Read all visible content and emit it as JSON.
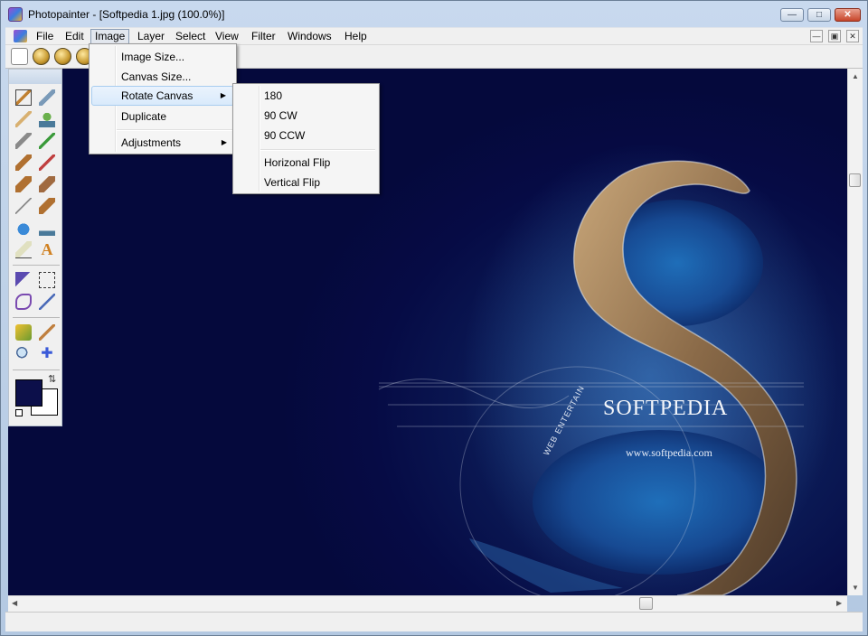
{
  "window": {
    "title": "Photopainter - [Softpedia 1.jpg  (100.0%)]",
    "controls": [
      "minimize",
      "maximize",
      "close"
    ]
  },
  "menubar": {
    "items": [
      "File",
      "Edit",
      "Image",
      "Layer",
      "Select",
      "View",
      "Filter",
      "Windows",
      "Help"
    ],
    "active": "Image"
  },
  "toolbar": {
    "buttons": [
      "new-icon",
      "open-icon",
      "save-icon",
      "print-icon"
    ]
  },
  "image_menu": {
    "items": [
      {
        "label": "Image Size..."
      },
      {
        "label": "Canvas Size..."
      },
      {
        "label": "Rotate Canvas",
        "submenu": true,
        "highlighted": true
      },
      {
        "label": "Duplicate"
      },
      {
        "label": "Adjustments",
        "submenu": true
      }
    ]
  },
  "rotate_submenu": {
    "items": [
      "180",
      "90 CW",
      "90 CCW",
      "Horizonal Flip",
      "Vertical Flip"
    ]
  },
  "canvas": {
    "watermark_title": "SOFTPEDIA",
    "watermark_url": "www.softpedia.com",
    "watermark_curve_text": "WEB  ENTERTAIN"
  },
  "colors": {
    "foreground": "#0c0f4a",
    "background": "#ffffff",
    "canvas_bg": "#060b45"
  },
  "tools": [
    "brush-icon",
    "airbrush-icon",
    "pencil-icon",
    "stamp-icon",
    "smudge-icon",
    "pen-icon",
    "paint-icon",
    "dropper-icon",
    "fill-icon",
    "bucket-icon",
    "wand-icon",
    "brush2-icon",
    "blur-icon",
    "sharpen-icon",
    "eraser-icon",
    "text-icon",
    "move-selection-icon",
    "rect-select-icon",
    "lasso-icon",
    "magic-wand-icon",
    "gradient-icon",
    "color-picker-icon",
    "zoom-icon",
    "move-icon"
  ]
}
